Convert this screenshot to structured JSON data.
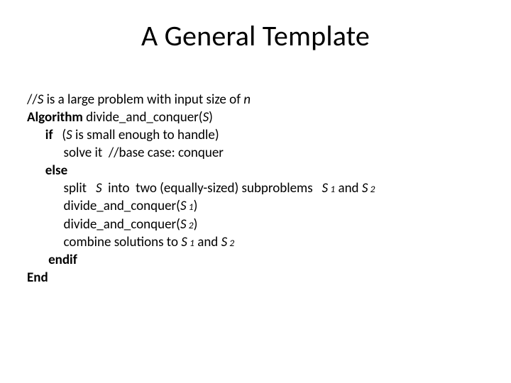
{
  "title": "A General Template",
  "line1": {
    "prefix": "//",
    "s": "S",
    "mid": " is a large problem with input size of ",
    "n": "n"
  },
  "line2": {
    "head": "Algorithm ",
    "name": "divide_and_conquer(",
    "arg": "S",
    "close": ")"
  },
  "line3": {
    "indent": "      ",
    "kw": "if",
    "open": "   (",
    "s": "S",
    "rest": " is small enough to handle)"
  },
  "line4": {
    "indent": "            ",
    "text": "solve it  //base case: conquer"
  },
  "line5": {
    "indent": "      ",
    "kw": "else"
  },
  "line6": {
    "indent": "            ",
    "a": "split   ",
    "s": "S",
    "b": "  into  two (equally-sized) subproblems   ",
    "s1a": "S",
    "s1b": " 1",
    "and": " and ",
    "s2a": "S",
    "s2b": " 2"
  },
  "line7": {
    "indent": "            ",
    "fn": "divide_and_conquer(",
    "arg": "S",
    "sub": " 1",
    "close": ")"
  },
  "line8": {
    "indent": "            ",
    "fn": "divide_and_conquer(",
    "arg": "S",
    "sub": " 2",
    "close": ")"
  },
  "line9": {
    "indent": "            ",
    "a": "combine solutions to ",
    "s1a": "S",
    "s1b": " 1",
    "and": " and ",
    "s2a": "S",
    "s2b": " 2"
  },
  "line10": {
    "indent": "       ",
    "kw": "endif"
  },
  "line11": {
    "kw": "End"
  }
}
